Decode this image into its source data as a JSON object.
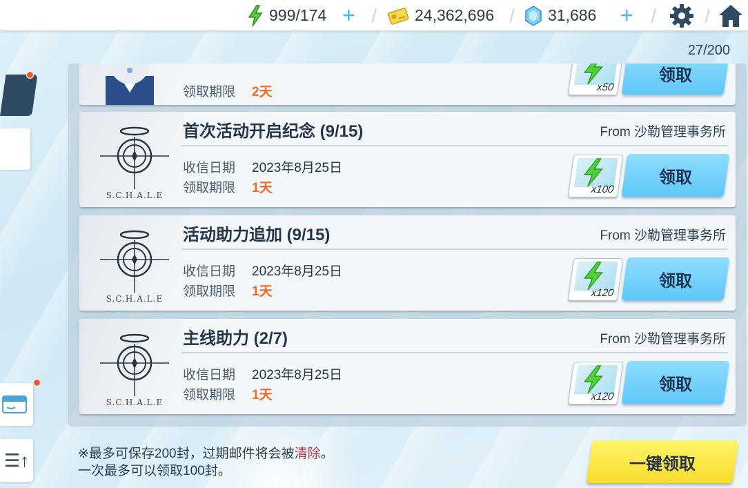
{
  "topbar": {
    "ap": "999/174",
    "credits": "24,362,696",
    "gems": "31,686",
    "icons": [
      "bolt-icon",
      "credit-card-icon",
      "gem-icon",
      "settings-gear-icon",
      "home-icon"
    ]
  },
  "mailbox": {
    "count": "27/200",
    "date_label": "收信日期",
    "expire_label": "领取期限",
    "claim_label": "领取",
    "partial": {
      "expire_value": "2天",
      "qty": "x50",
      "claim_label": "领取"
    },
    "mails": [
      {
        "title": "首次活动开启纪念 (9/15)",
        "from": "From 沙勒管理事务所",
        "date": "2023年8月25日",
        "expire": "1天",
        "qty": "x100",
        "logo_text": "S.C.H.A.L.E"
      },
      {
        "title": "活动助力追加 (9/15)",
        "from": "From 沙勒管理事务所",
        "date": "2023年8月25日",
        "expire": "1天",
        "qty": "x120",
        "logo_text": "S.C.H.A.L.E"
      },
      {
        "title": "主线助力 (2/7)",
        "from": "From 沙勒管理事务所",
        "date": "2023年8月25日",
        "expire": "1天",
        "qty": "x120",
        "logo_text": "S.C.H.A.L.E"
      }
    ]
  },
  "footer": {
    "note1_a": "※最多可保存200封，过期邮件将会被",
    "note1_red": "清除",
    "note1_b": "。",
    "note2": "一次最多可以领取100封。",
    "claim_all_label": "一键领取"
  },
  "colors": {
    "accent_blue": "#5ec7f7",
    "claim_all_yellow": "#f7dc2a",
    "expire_orange": "#f06a24",
    "notice_dot": "#f05a2a"
  }
}
